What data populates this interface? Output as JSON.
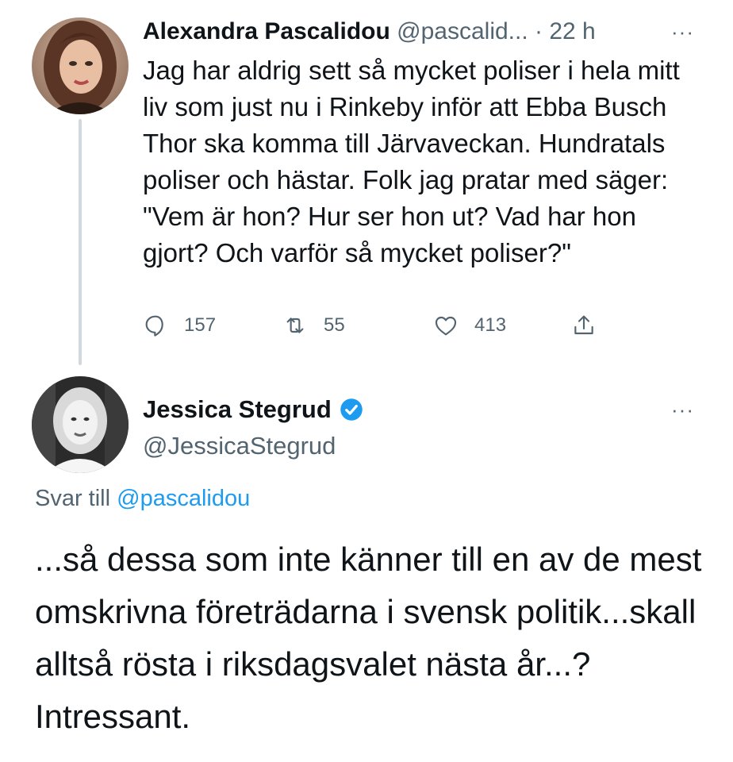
{
  "tweet1": {
    "author_name": "Alexandra Pascalidou",
    "author_handle": "@pascalid...",
    "time": "· 22 h",
    "text": "Jag har aldrig sett så mycket poliser i hela mitt liv som just nu i Rinkeby inför att Ebba Busch Thor ska komma till Järvaveckan. Hundratals poliser och hästar. Folk jag pratar med säger: \"Vem är hon? Hur ser hon ut? Vad har hon gjort? Och varför så mycket poliser?\"",
    "replies": "157",
    "retweets": "55",
    "likes": "413",
    "more_label": "···"
  },
  "tweet2": {
    "author_name": "Jessica Stegrud",
    "author_handle": "@JessicaStegrud",
    "verified": true,
    "more_label": "···",
    "replying_prefix": "Svar till",
    "replying_handle": "@pascalidou",
    "text": "...så dessa som inte känner till en av de mest omskrivna företrädarna i svensk politik...skall alltså rösta i riksdagsvalet nästa år...? Intressant."
  },
  "colors": {
    "text": "#0f1419",
    "muted": "#536471",
    "accent": "#1d9bf0",
    "thread_line": "#cfd9de"
  },
  "icons": [
    "reply-icon",
    "retweet-icon",
    "like-icon",
    "share-icon",
    "verified-badge-icon",
    "more-icon"
  ]
}
